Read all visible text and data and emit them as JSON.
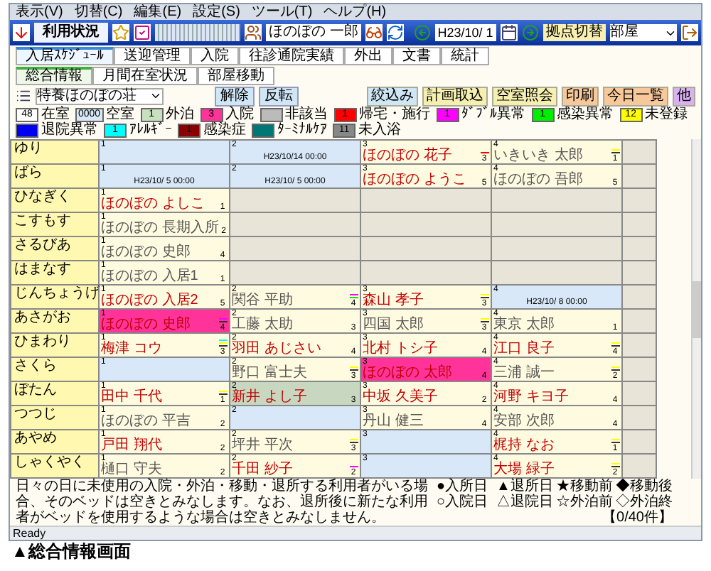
{
  "menu": [
    "表示(V)",
    "切替(C)",
    "編集(E)",
    "設定(S)",
    "ツール(T)",
    "ヘルプ(H)"
  ],
  "toolbar": {
    "title": "利用状況",
    "user": "ほのぼの 一郎",
    "date": "H23/10/ 1",
    "switch_button": "拠点切替",
    "view_select": "部屋"
  },
  "tabs": [
    {
      "label": "入居ｽｹｼﾞｭｰﾙ",
      "selected": true
    },
    {
      "label": "送迎管理",
      "selected": false
    },
    {
      "label": "入院",
      "selected": false
    },
    {
      "label": "往診通院実績",
      "selected": false
    },
    {
      "label": "外出",
      "selected": false
    },
    {
      "label": "文書",
      "selected": false
    },
    {
      "label": "統計",
      "selected": false
    }
  ],
  "sub_tabs": [
    {
      "label": "総合情報",
      "selected": true
    },
    {
      "label": "月間在室状況",
      "selected": false
    },
    {
      "label": "部屋移動",
      "selected": false
    }
  ],
  "facility_select": "特養ほのぼの荘",
  "left_buttons": [
    "解除",
    "反転"
  ],
  "right_buttons": [
    {
      "label": "絞込み",
      "color": "#cfe6f5"
    },
    {
      "label": "計画取込",
      "color": "#f5efb0"
    },
    {
      "label": "空室照会",
      "color": "#f5efb0"
    },
    {
      "label": "印刷",
      "color": "#f7c89a"
    },
    {
      "label": "今日一覧",
      "color": "#f7c89a"
    },
    {
      "label": "他",
      "color": "#d9b0f0"
    }
  ],
  "legend": [
    {
      "count": "48",
      "label": "在室",
      "color": "#ffffff"
    },
    {
      "count": "0000",
      "label": "空室",
      "color": "#d8e8f8"
    },
    {
      "count": "1",
      "label": "外泊",
      "color": "#c8e0c0"
    },
    {
      "count": "3",
      "label": "入院",
      "color": "#ff3399"
    },
    {
      "label": "非該当",
      "color": "#bbbbbb"
    },
    {
      "count": "1",
      "label": "帰宅・施行",
      "color": "#ff0000"
    },
    {
      "count": "1",
      "label": "ﾀﾞﾌﾞﾙ異常",
      "color": "#ff00ff"
    },
    {
      "count": "1",
      "label": "感染異常",
      "color": "#00ee00"
    },
    {
      "count": "12",
      "label": "未登録",
      "color": "#ffff00"
    },
    {
      "label": "退院異常",
      "color": "#0000ee"
    },
    {
      "count": "1",
      "label": "ｱﾚﾙｷﾞｰ",
      "color": "#00ffff"
    },
    {
      "count": "1",
      "label": "感染症",
      "color": "#8b0000"
    },
    {
      "label": "ﾀｰﾐﾅﾙｹｱ",
      "color": "#007777"
    },
    {
      "count": "11",
      "label": "未入浴",
      "color": "#888888"
    }
  ],
  "rooms": [
    {
      "name": "ゆり",
      "beds": [
        {
          "bed": "1",
          "kind": "vacant"
        },
        {
          "bed": "2",
          "kind": "vacant",
          "date": "H23/10/14 00:00"
        },
        {
          "bed": "3",
          "kind": "occupied",
          "name": "ほのぼの 花子",
          "alert": true,
          "count": "3",
          "marks": [
            {
              "color": "#ff0000"
            }
          ]
        },
        {
          "bed": "4",
          "kind": "occupied",
          "name": "いきいき 太郎",
          "alert": false,
          "count": "1",
          "marks": [
            {
              "color": "#ffff00"
            },
            {
              "color": "#333333"
            }
          ]
        }
      ]
    },
    {
      "name": "ばら",
      "beds": [
        {
          "bed": "1",
          "kind": "vacant",
          "date": "H23/10/ 5 00:00"
        },
        {
          "bed": "2",
          "kind": "vacant",
          "date": "H23/10/ 5 00:00"
        },
        {
          "bed": "3",
          "kind": "occupied",
          "name": "ほのぼの ようこ",
          "alert": true,
          "count": "5"
        },
        {
          "bed": "4",
          "kind": "occupied",
          "name": "ほのぼの 吾郎",
          "alert": false,
          "count": "5"
        }
      ]
    },
    {
      "name": "ひなぎく",
      "beds": [
        {
          "bed": "1",
          "kind": "occupied",
          "name": "ほのぼの よしこ",
          "alert": true,
          "count": "1"
        },
        {
          "kind": "none"
        },
        {
          "kind": "none"
        },
        {
          "kind": "none"
        }
      ]
    },
    {
      "name": "こすもす",
      "beds": [
        {
          "bed": "1",
          "kind": "occupied",
          "name": "ほのぼの 長期入所",
          "alert": false,
          "count": "2"
        },
        {
          "kind": "none"
        },
        {
          "kind": "none"
        },
        {
          "kind": "none"
        }
      ]
    },
    {
      "name": "さるびあ",
      "beds": [
        {
          "bed": "1",
          "kind": "occupied",
          "name": "ほのぼの 史郎",
          "alert": false,
          "count": "4"
        },
        {
          "kind": "none"
        },
        {
          "kind": "none"
        },
        {
          "kind": "none"
        }
      ]
    },
    {
      "name": "はまなす",
      "beds": [
        {
          "bed": "1",
          "kind": "occupied",
          "name": "ほのぼの 入居1",
          "alert": false,
          "count": "1"
        },
        {
          "kind": "none"
        },
        {
          "kind": "none"
        },
        {
          "kind": "none"
        }
      ]
    },
    {
      "name": "じんちょうげ",
      "beds": [
        {
          "bed": "1",
          "kind": "occupied",
          "name": "ほのぼの 入居2",
          "alert": true,
          "count": "5"
        },
        {
          "bed": "2",
          "kind": "occupied",
          "name": "関谷 平助",
          "alert": false,
          "count": "4",
          "marks": [
            {
              "color": "#ff00ff"
            },
            {
              "color": "#00ee00"
            }
          ]
        },
        {
          "bed": "3",
          "kind": "occupied",
          "name": "森山 孝子",
          "alert": true,
          "count": "3",
          "marks": [
            {
              "color": "#ffff00"
            },
            {
              "color": "#333333"
            }
          ]
        },
        {
          "bed": "4",
          "kind": "vacant",
          "date": "H23/10/ 8 00:00"
        }
      ]
    },
    {
      "name": "あさがお",
      "beds": [
        {
          "bed": "1",
          "kind": "admission",
          "name": "ほのぼの 史郎",
          "alert": true,
          "count": "4",
          "marks": [
            {
              "color": "#ff00ff"
            },
            {
              "color": "#333333"
            }
          ]
        },
        {
          "bed": "2",
          "kind": "occupied",
          "name": "工藤 太助",
          "alert": false,
          "count": "3"
        },
        {
          "bed": "3",
          "kind": "occupied",
          "name": "四国 太郎",
          "alert": false,
          "count": "3",
          "marks": [
            {
              "color": "#ffff00"
            },
            {
              "color": "#333333"
            }
          ]
        },
        {
          "bed": "4",
          "kind": "occupied",
          "name": "東京 太郎",
          "alert": false,
          "count": "1"
        }
      ]
    },
    {
      "name": "ひまわり",
      "beds": [
        {
          "bed": "1",
          "kind": "occupied",
          "name": "梅津 コウ",
          "alert": true,
          "count": "3",
          "marks": [
            {
              "color": "#00ffff"
            },
            {
              "color": "#ffff00"
            },
            {
              "color": "#333333"
            }
          ]
        },
        {
          "bed": "2",
          "kind": "occupied",
          "name": "羽田 あじさい",
          "alert": true,
          "count": "4"
        },
        {
          "bed": "3",
          "kind": "occupied",
          "name": "北村 トシ子",
          "alert": true,
          "count": "4"
        },
        {
          "bed": "4",
          "kind": "occupied",
          "name": "江口 良子",
          "alert": true,
          "count": "4",
          "marks": [
            {
              "color": "#ffff00"
            },
            {
              "color": "#333333"
            }
          ]
        }
      ]
    },
    {
      "name": "さくら",
      "beds": [
        {
          "bed": "1",
          "kind": "vacant"
        },
        {
          "bed": "2",
          "kind": "occupied",
          "name": "野口 富士夫",
          "alert": false,
          "count": "3",
          "marks": [
            {
              "color": "#ffff00"
            },
            {
              "color": "#333333"
            }
          ]
        },
        {
          "bed": "3",
          "kind": "admission",
          "name": "ほのぼの 太郎",
          "alert": true,
          "count": "4"
        },
        {
          "bed": "4",
          "kind": "occupied",
          "name": "三浦 誠一",
          "alert": false,
          "count": "2",
          "marks": [
            {
              "color": "#ffff00"
            },
            {
              "color": "#333333"
            }
          ]
        }
      ]
    },
    {
      "name": "ぼたん",
      "beds": [
        {
          "bed": "1",
          "kind": "occupied",
          "name": "田中 千代",
          "alert": true,
          "count": "1",
          "marks": [
            {
              "color": "#ffff00"
            },
            {
              "color": "#333333"
            }
          ]
        },
        {
          "bed": "2",
          "kind": "outing",
          "name": "新井 よし子",
          "alert": true,
          "count": "3"
        },
        {
          "bed": "3",
          "kind": "occupied",
          "name": "中坂 久美子",
          "alert": true,
          "count": "2"
        },
        {
          "bed": "4",
          "kind": "occupied",
          "name": "河野 キヨ子",
          "alert": true,
          "count": "4"
        }
      ]
    },
    {
      "name": "つつじ",
      "beds": [
        {
          "bed": "1",
          "kind": "occupied",
          "name": "ほのぼの 平吉",
          "alert": false,
          "count": "2"
        },
        {
          "bed": "2",
          "kind": "vacant"
        },
        {
          "bed": "3",
          "kind": "occupied",
          "name": "丹山 健三",
          "alert": false,
          "count": "4"
        },
        {
          "bed": "4",
          "kind": "occupied",
          "name": "安部 次郎",
          "alert": false,
          "count": "4"
        }
      ]
    },
    {
      "name": "あやめ",
      "beds": [
        {
          "bed": "1",
          "kind": "occupied",
          "name": "戸田 翔代",
          "alert": true,
          "count": "2"
        },
        {
          "bed": "2",
          "kind": "occupied",
          "name": "坪井 平次",
          "alert": false,
          "count": "3",
          "marks": [
            {
              "color": "#ffff00"
            },
            {
              "color": "#333333"
            }
          ]
        },
        {
          "bed": "3",
          "kind": "vacant"
        },
        {
          "bed": "4",
          "kind": "occupied",
          "name": "梶持 なお",
          "alert": true,
          "count": "1",
          "marks": [
            {
              "color": "#ffff00"
            },
            {
              "color": "#333333"
            }
          ]
        }
      ]
    },
    {
      "name": "しゃくやく",
      "beds": [
        {
          "bed": "1",
          "kind": "occupied",
          "name": "樋口 守夫",
          "alert": false,
          "count": "2"
        },
        {
          "bed": "2",
          "kind": "occupied",
          "name": "千田 紗子",
          "alert": true,
          "count": "2",
          "marks": [
            {
              "color": "#ff00ff"
            }
          ]
        },
        {
          "bed": "3",
          "kind": "vacant"
        },
        {
          "bed": "4",
          "kind": "occupied",
          "name": "大場 緑子",
          "alert": true,
          "count": "2",
          "marks": [
            {
              "color": "#ffff00"
            },
            {
              "color": "#333333"
            }
          ]
        }
      ]
    }
  ],
  "footnote": "日々の日に未使用の入院・外泊・移動・退所する利用者がいる場合、そのベッドは空きとみなします。なお、退所後に新たな利用者がベッドを使用するような場合は空きとみなしません。",
  "symbols": [
    "●入所日",
    "▲退所日",
    "★移動前",
    "◆移動後",
    "○入院日",
    "△退院日",
    "☆外泊前",
    "◇外泊終"
  ],
  "record_count": "【0/40件】",
  "status_bar": "Ready",
  "caption": "▲総合情報画面"
}
